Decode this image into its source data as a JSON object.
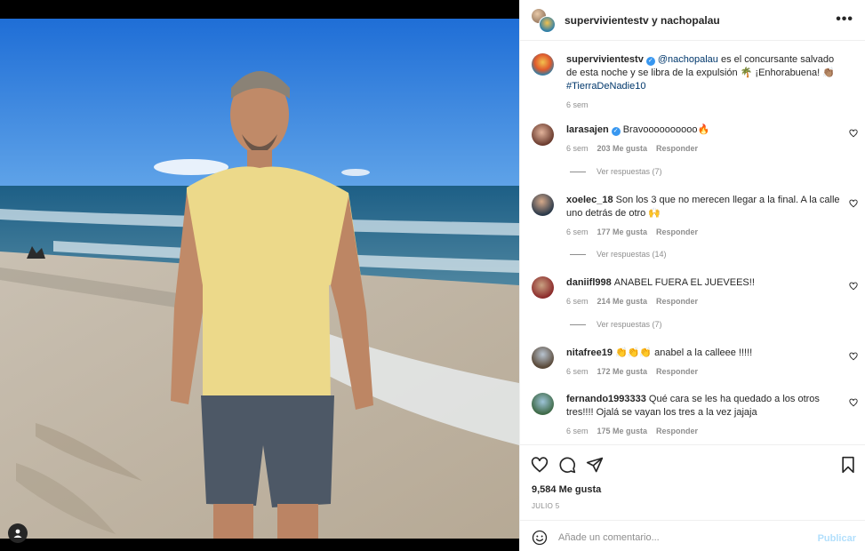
{
  "header": {
    "title": "supervivientestv y nachopalau",
    "more_icon": "more-horizontal-icon"
  },
  "caption": {
    "username": "supervivientestv",
    "mention": "@nachopalau",
    "text": "es el concursante salvado de esta noche y se libra de la expulsión 🌴 ¡Enhorabuena! 👏🏽",
    "hashtag": "#TierraDeNadie10",
    "time": "6 sem"
  },
  "comments": [
    {
      "username": "larasajen",
      "verified": true,
      "text": "Bravoooooooooo🔥",
      "time": "6 sem",
      "likes": "203 Me gusta",
      "reply": "Responder",
      "replies": "Ver respuestas (7)"
    },
    {
      "username": "xoelec_18",
      "verified": false,
      "text": "Son los 3 que no merecen llegar a la final. A la calle uno detrás de otro 🙌",
      "time": "6 sem",
      "likes": "177 Me gusta",
      "reply": "Responder",
      "replies": "Ver respuestas (14)"
    },
    {
      "username": "daniifl998",
      "verified": false,
      "text": "ANABEL FUERA EL JUEVEES!!",
      "time": "6 sem",
      "likes": "214 Me gusta",
      "reply": "Responder",
      "replies": "Ver respuestas (7)"
    },
    {
      "username": "nitafree19",
      "verified": false,
      "text": "👏👏👏 anabel a la calleee !!!!!",
      "time": "6 sem",
      "likes": "172 Me gusta",
      "reply": "Responder"
    },
    {
      "username": "fernando1993333",
      "verified": false,
      "text": "Qué cara se les ha quedado a los otros tres!!!! Ojalá se vayan los tres a la vez jajaja",
      "time": "6 sem",
      "likes": "175 Me gusta",
      "reply": "Responder"
    }
  ],
  "actions": {
    "like_icon": "heart-icon",
    "comment_icon": "comment-icon",
    "share_icon": "send-icon",
    "save_icon": "bookmark-icon"
  },
  "likes": "9,584 Me gusta",
  "date": "JULIO 5",
  "composer": {
    "placeholder": "Añade un comentario...",
    "publish": "Publicar",
    "emoji_icon": "emoji-icon"
  },
  "colors": {
    "link": "#00376b",
    "verified": "#3897f0",
    "publish_disabled": "#b2dffc",
    "muted": "#8e8e8e"
  }
}
